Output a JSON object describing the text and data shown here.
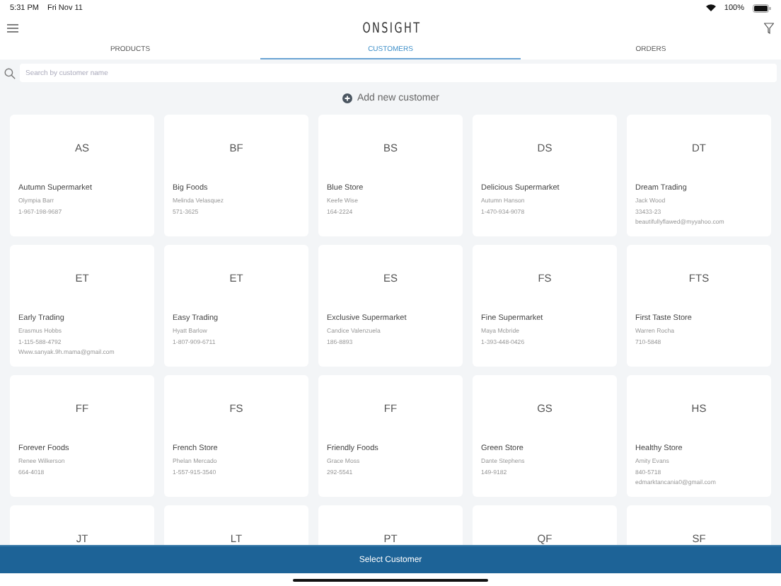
{
  "status_bar": {
    "time": "5:31 PM",
    "date": "Fri Nov 11",
    "battery": "100%"
  },
  "header": {
    "logo": "ONSIGHT"
  },
  "tabs": [
    {
      "label": "PRODUCTS",
      "selected": false
    },
    {
      "label": "CUSTOMERS",
      "selected": true
    },
    {
      "label": "ORDERS",
      "selected": false
    }
  ],
  "search": {
    "placeholder": "Search by customer name"
  },
  "add_button": {
    "label": "Add new customer"
  },
  "customers": [
    {
      "initials": "AS",
      "name": "Autumn Supermarket",
      "contact": "Olympia Barr",
      "phone": "1-967-198-9687"
    },
    {
      "initials": "BF",
      "name": "Big Foods",
      "contact": "Melinda Velasquez",
      "phone": "571-3625"
    },
    {
      "initials": "BS",
      "name": "Blue Store",
      "contact": "Keefe Wise",
      "phone": "164-2224"
    },
    {
      "initials": "DS",
      "name": "Delicious Supermarket",
      "contact": "Autumn Hanson",
      "phone": "1-470-934-9078"
    },
    {
      "initials": "DT",
      "name": "Dream Trading",
      "contact": "Jack Wood",
      "phone": "33433-23",
      "email": "beautifullyflawed@myyahoo.com"
    },
    {
      "initials": "ET",
      "name": "Early Trading",
      "contact": "Erasmus Hobbs",
      "phone": "1-115-588-4792",
      "email": "Www.sanyak.9h.mama@gmail.com"
    },
    {
      "initials": "ET",
      "name": "Easy Trading",
      "contact": "Hyatt Barlow",
      "phone": "1-807-909-6711"
    },
    {
      "initials": "ES",
      "name": "Exclusive Supermarket",
      "contact": "Candice Valenzuela",
      "phone": "186-8893"
    },
    {
      "initials": "FS",
      "name": "Fine Supermarket",
      "contact": "Maya Mcbride",
      "phone": "1-393-448-0426"
    },
    {
      "initials": "FTS",
      "name": "First Taste Store",
      "contact": "Warren Rocha",
      "phone": "710-5848"
    },
    {
      "initials": "FF",
      "name": "Forever Foods",
      "contact": "Renee Wilkerson",
      "phone": "664-4018"
    },
    {
      "initials": "FS",
      "name": "French Store",
      "contact": "Phelan Mercado",
      "phone": "1-557-915-3540"
    },
    {
      "initials": "FF",
      "name": "Friendly Foods",
      "contact": "Grace Moss",
      "phone": "292-5541"
    },
    {
      "initials": "GS",
      "name": "Green Store",
      "contact": "Dante Stephens",
      "phone": "149-9182"
    },
    {
      "initials": "HS",
      "name": "Healthy Store",
      "contact": "Amity Evans",
      "phone": "840-5718",
      "email": "edmarktancania0@gmail.com"
    },
    {
      "initials": "JT"
    },
    {
      "initials": "LT"
    },
    {
      "initials": "PT"
    },
    {
      "initials": "QF"
    },
    {
      "initials": "SF"
    }
  ],
  "bottom_button": {
    "label": "Select Customer"
  }
}
